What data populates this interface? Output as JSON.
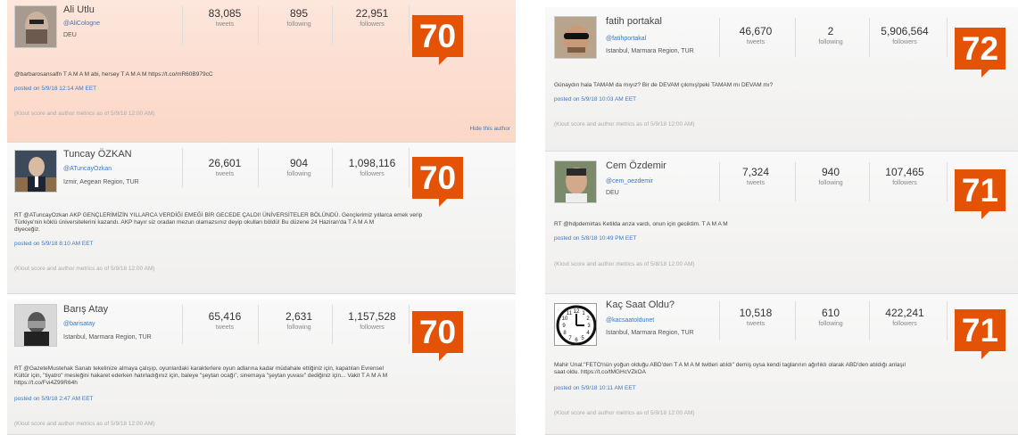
{
  "stat_labels": {
    "tweets": "tweets",
    "following": "following",
    "followers": "followers"
  },
  "posted_prefix": "posted on",
  "cards": [
    {
      "name": "Ali Utlu",
      "handle": "@AliCologne",
      "location": "DEU",
      "tweets": "83,085",
      "following": "895",
      "followers": "22,951",
      "score": "70",
      "tweet": "@barbarosansalfn T A M A M abi, hersey T A M A M https://t.co/mR60B979cC",
      "posted": "posted on 5/9/18 12:14 AM EET",
      "note": "(Klout score and author metrics as of 5/9/18 12:00 AM)",
      "hide": "Hide this author"
    },
    {
      "name": "Tuncay ÖZKAN",
      "handle": "@ATuncayOzkan",
      "location": "Izmir, Aegean Region, TUR",
      "tweets": "26,601",
      "following": "904",
      "followers": "1,098,116",
      "score": "70",
      "tweet_line1": "RT @ATuncayOzkan AKP GENÇLERİMİZİN YILLARCA VERDİĞİ EMEĞİ BİR GECEDE ÇALDI! ÜNİVERSİTELER BÖLÜNDÜ. Gençlerimiz yıllarca emek verip",
      "tweet_line2": "Türkiye'nin köklü üniversitelerini kazandı. AKP hayır siz oradan mezun olamazsınız deyip okulları böldü! Bu düzene 24 Haziran'da T A M A M",
      "tweet_line3": "diyeceğiz.",
      "posted": "posted on 5/9/18 8:10 AM EET",
      "note": "(Klout score and author metrics as of 5/9/18 12:00 AM)"
    },
    {
      "name": "Barış Atay",
      "handle": "@barisatay",
      "location": "Istanbul, Marmara Region, TUR",
      "tweets": "65,416",
      "following": "2,631",
      "followers": "1,157,528",
      "score": "70",
      "tweet_line1": "RT @GazeteMustehak Sanatı tekelinize almaya çalışıp, oyunlardaki karakterlere oyun adlarına kadar müdahale ettiğiniz için, kapatılan Evrensel",
      "tweet_line2": "Kültür için, \"tiyatro\" mesleğini hakaret ederken hatırladığınız için, baleye \"şeytan ocağı\", sinemaya \"şeytan yuvası\" dediğiniz için... Vakit T A M A M",
      "tweet_line3": "https://t.co/Fvi4Z99R64h",
      "posted": "posted on 5/9/18 2:47 AM EET",
      "note": "(Klout score and author metrics as of 5/9/18 12:00 AM)"
    },
    {
      "name": "fatih portakal",
      "handle": "@fatihportakal",
      "location": "Istanbul, Marmara Region, TUR",
      "tweets": "46,670",
      "following": "2",
      "followers": "5,906,564",
      "score": "72",
      "tweet": "Günaydın hala TAMAM da mıyız? Bir de DEVAM çıkmış!peki TAMAM mı DEVAM mı?",
      "posted": "posted on 5/9/18 10:03 AM EET",
      "note": "(Klout score and author metrics as of 5/9/18 12:00 AM)"
    },
    {
      "name": "Cem Özdemir",
      "handle": "@cem_oezdemir",
      "location": "DEU",
      "tweets": "7,324",
      "following": "940",
      "followers": "107,465",
      "score": "71",
      "tweet": "RT @hdpdemirtas Ketilda arıza vardı, onun için geciktim. T A M A M",
      "posted": "posted on 5/8/18 10:49 PM EET",
      "note": "(Klout score and author metrics as of 5/8/18 12:00 AM)"
    },
    {
      "name": "Kaç Saat Oldu?",
      "handle": "@kacsaatoldunet",
      "location": "Istanbul, Marmara Region, TUR",
      "tweets": "10,518",
      "following": "610",
      "followers": "422,241",
      "score": "71",
      "tweet_line1": "Mahir Ünal:\"FETÖ'nün yoğun olduğu ABD'den T A M A M twitleri atıldı\" demiş oysa kendi taglarının ağırlıklı olarak ABD'den atıldığı anlaşıl",
      "tweet_line2": "saat oldu. https://t.co/tMGHcVZkOA",
      "posted": "posted on 5/9/18 10:11 AM EET",
      "note": "(Klout score and author metrics as of 5/9/18 12:00 AM)"
    }
  ]
}
